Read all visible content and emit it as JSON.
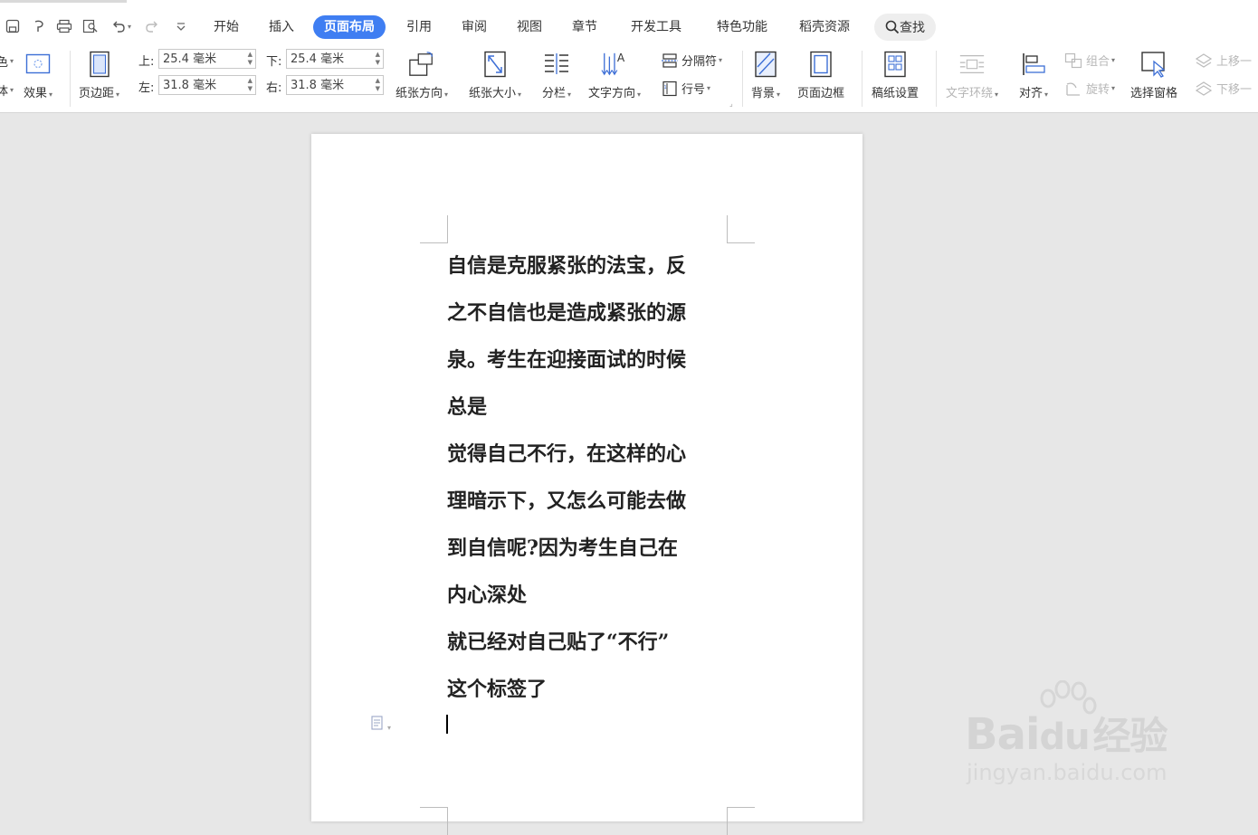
{
  "menubar": {
    "tabs": [
      "开始",
      "插入",
      "页面布局",
      "引用",
      "审阅",
      "视图",
      "章节",
      "开发工具",
      "特色功能",
      "稻壳资源"
    ],
    "active_tab": "页面布局",
    "search_label": "查找"
  },
  "ribbon": {
    "cut_left_top": "色",
    "cut_left_bottom": "体",
    "effect": "效果",
    "margins": "页边距",
    "margin_top_label": "上:",
    "margin_top_value": "25.4 毫米",
    "margin_bottom_label": "下:",
    "margin_bottom_value": "25.4 毫米",
    "margin_left_label": "左:",
    "margin_left_value": "31.8 毫米",
    "margin_right_label": "右:",
    "margin_right_value": "31.8 毫米",
    "orientation": "纸张方向",
    "paper_size": "纸张大小",
    "columns": "分栏",
    "text_direction": "文字方向",
    "separator": "分隔符",
    "line_numbers": "行号",
    "background": "背景",
    "page_border": "页面边框",
    "manuscript": "稿纸设置",
    "text_wrap": "文字环绕",
    "align": "对齐",
    "group": "组合",
    "rotate": "旋转",
    "selection_pane": "选择窗格",
    "bring_forward": "上移一",
    "send_backward": "下移一"
  },
  "document": {
    "lines": [
      "自信是克服紧张的法宝，反",
      "之不自信也是造成紧张的源",
      "泉。考生在迎接面试的时候",
      "总是",
      "觉得自己不行，在这样的心",
      "理暗示下，又怎么可能去做",
      "到自信呢?因为考生自己在",
      "内心深处",
      "就已经对自己贴了“不行”",
      "这个标签了"
    ]
  },
  "watermark": {
    "brand": "Bai",
    "brand2": "du",
    "cn": "经验",
    "url": "jingyan.baidu.com"
  },
  "colors": {
    "accent": "#3f7ef2",
    "canvas": "#e7e7e7",
    "page": "#ffffff"
  },
  "icons": [
    "save-icon",
    "undo-icon",
    "print-icon",
    "preview-icon",
    "redo-icon",
    "search-icon"
  ]
}
